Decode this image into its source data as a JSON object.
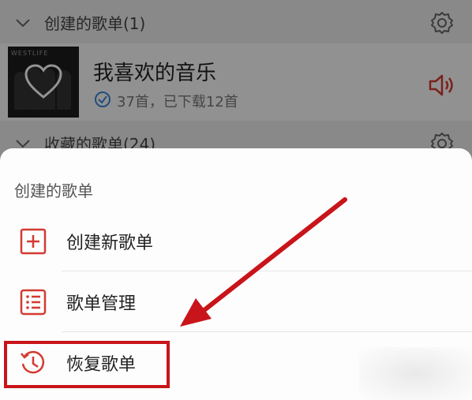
{
  "created_section": {
    "title": "创建的歌单(1)",
    "chevron_icon": "chevron-down-icon",
    "gear_icon": "gear-icon"
  },
  "playlist": {
    "title": "我喜欢的音乐",
    "subtitle": "37首，已下载12首",
    "cover_text": "WESTLIFE",
    "status_icon": "check-circle-icon",
    "playing_icon": "speaker-icon",
    "accent": "#d33a31"
  },
  "collected_section": {
    "title": "收藏的歌单(24)"
  },
  "sheet": {
    "title": "创建的歌单",
    "items": [
      {
        "label": "创建新歌单",
        "icon": "add-square-icon"
      },
      {
        "label": "歌单管理",
        "icon": "list-icon"
      },
      {
        "label": "恢复歌单",
        "icon": "history-icon"
      }
    ]
  },
  "annotation": {
    "color": "#c8141a"
  }
}
